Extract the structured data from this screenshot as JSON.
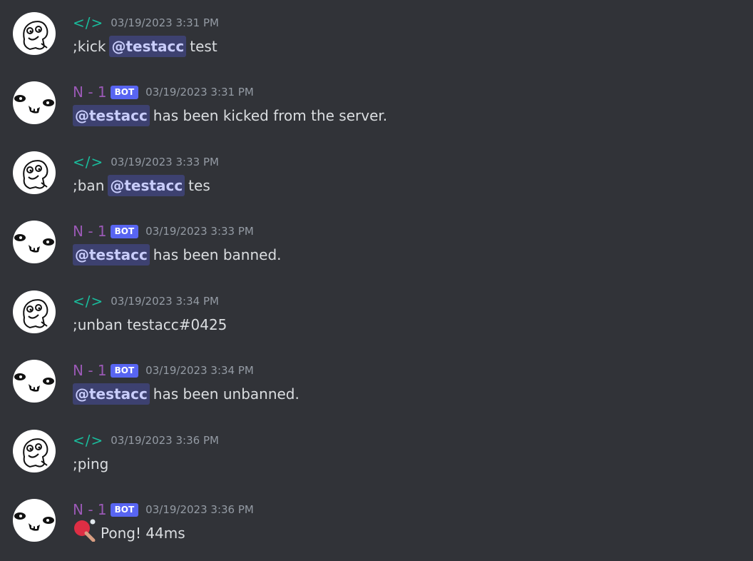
{
  "channel": {
    "messages": [
      {
        "author": "</>",
        "author_type": "user",
        "timestamp": "03/19/2023 3:31 PM",
        "before": ";kick",
        "mention": "@testacc",
        "after": "test"
      },
      {
        "author": "N - 1",
        "author_type": "bot",
        "bot_tag": "BOT",
        "timestamp": "03/19/2023 3:31 PM",
        "mention": "@testacc",
        "after": "has been kicked from the server."
      },
      {
        "author": "</>",
        "author_type": "user",
        "timestamp": "03/19/2023 3:33 PM",
        "before": ";ban",
        "mention": "@testacc",
        "after": "tes"
      },
      {
        "author": "N - 1",
        "author_type": "bot",
        "bot_tag": "BOT",
        "timestamp": "03/19/2023 3:33 PM",
        "mention": "@testacc",
        "after": "has been banned."
      },
      {
        "author": "</>",
        "author_type": "user",
        "timestamp": "03/19/2023 3:34 PM",
        "text": ";unban testacc#0425"
      },
      {
        "author": "N - 1",
        "author_type": "bot",
        "bot_tag": "BOT",
        "timestamp": "03/19/2023 3:34 PM",
        "mention": "@testacc",
        "after": "has been unbanned."
      },
      {
        "author": "</>",
        "author_type": "user",
        "timestamp": "03/19/2023 3:36 PM",
        "text": ";ping"
      },
      {
        "author": "N - 1",
        "author_type": "bot",
        "bot_tag": "BOT",
        "timestamp": "03/19/2023 3:36 PM",
        "icon": "ping-pong-icon",
        "text": "Pong! 44ms"
      }
    ]
  },
  "colors": {
    "background": "#313338",
    "user_name": "#1abc9c",
    "bot_name": "#9b59b6",
    "bot_tag": "#5865f2",
    "timestamp": "#949ba4",
    "text": "#dbdee1",
    "mention_bg": "rgba(88,101,242,0.3)",
    "mention_text": "#c9cdfb"
  }
}
